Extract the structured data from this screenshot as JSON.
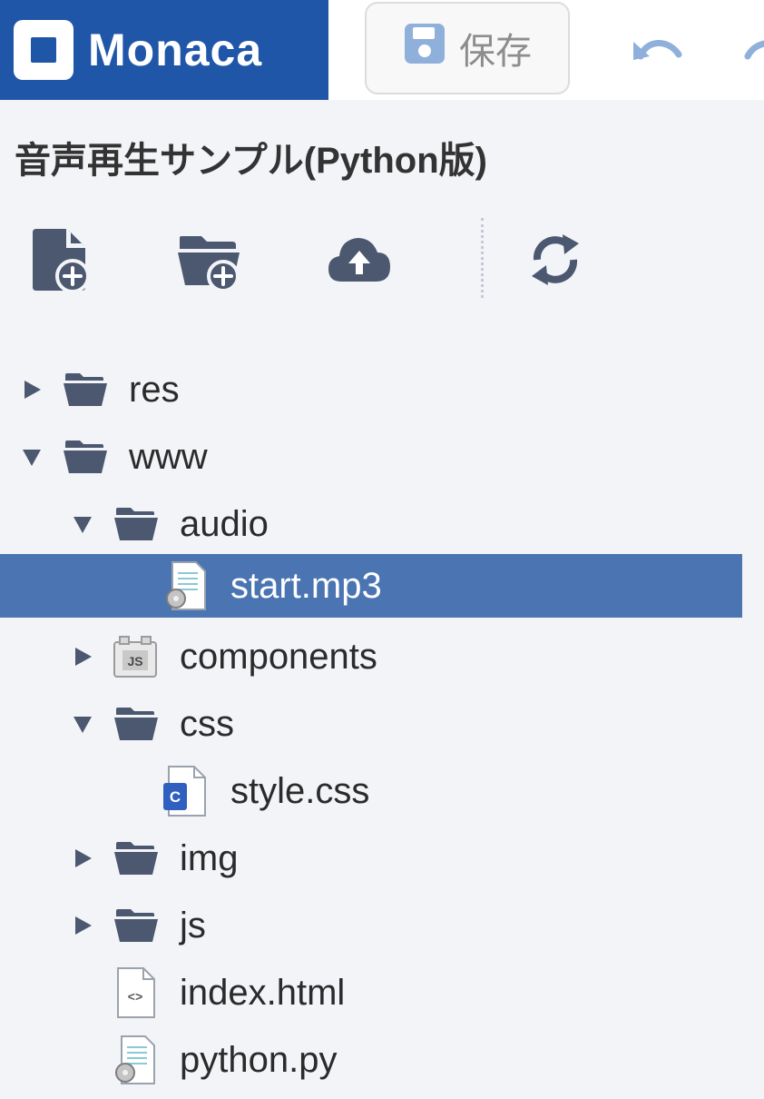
{
  "header": {
    "brand": "Monaca",
    "save_label": "保存"
  },
  "project": {
    "title": "音声再生サンプル(Python版)"
  },
  "toolbar": {
    "icons": [
      "new-file-icon",
      "new-folder-icon",
      "upload-icon",
      "refresh-icon"
    ]
  },
  "tree": [
    {
      "label": "res",
      "type": "folder",
      "expanded": false
    },
    {
      "label": "www",
      "type": "folder",
      "expanded": true
    },
    {
      "label": "audio",
      "type": "folder",
      "expanded": true
    },
    {
      "label": "start.mp3",
      "type": "file-generic",
      "selected": true
    },
    {
      "label": "components",
      "type": "folder-js",
      "expanded": false
    },
    {
      "label": "css",
      "type": "folder",
      "expanded": true
    },
    {
      "label": "style.css",
      "type": "file-css"
    },
    {
      "label": "img",
      "type": "folder",
      "expanded": false
    },
    {
      "label": "js",
      "type": "folder",
      "expanded": false
    },
    {
      "label": "index.html",
      "type": "file-html"
    },
    {
      "label": "python.py",
      "type": "file-generic"
    }
  ],
  "colors": {
    "brand": "#1f56a8",
    "selection": "#4a74b2",
    "icon": "#4c5870",
    "background": "#f3f4f8"
  }
}
